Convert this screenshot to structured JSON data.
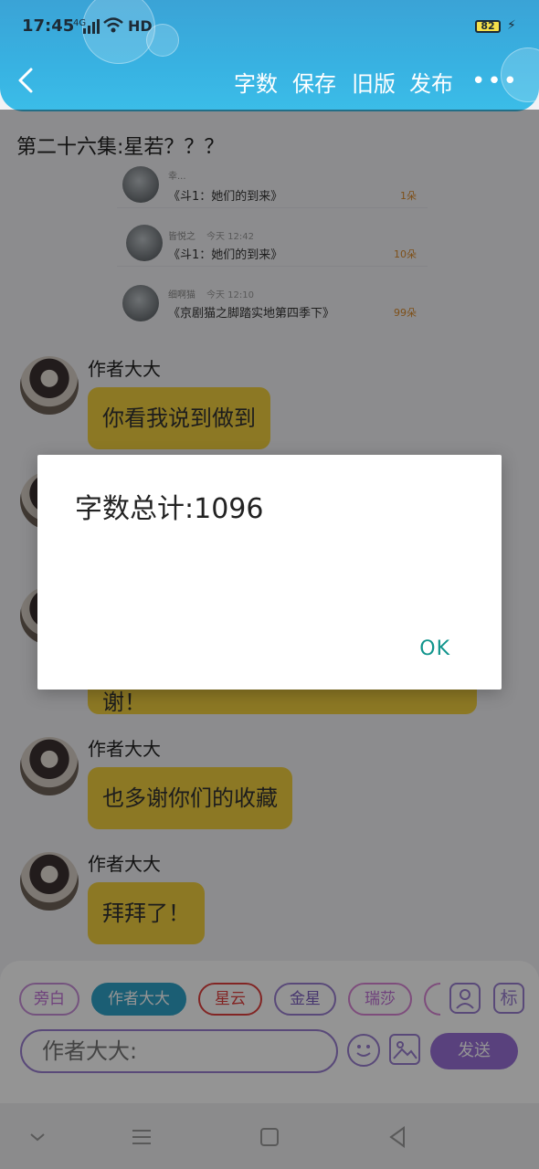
{
  "status_bar": {
    "time": "17:45",
    "network": "4G",
    "hd": "HD",
    "battery": "82"
  },
  "header": {
    "nav": [
      "字数",
      "保存",
      "旧版",
      "发布"
    ],
    "more": "•••"
  },
  "chapter_title": "第二十六集:星若？？？",
  "gift_list": [
    {
      "name": "幸...",
      "time": "",
      "book": "《斗1：她们的到来》",
      "amount": "1朵"
    },
    {
      "name": "皆悦之",
      "time": "今天 12:42",
      "book": "《斗1：她们的到来》",
      "amount": "10朵"
    },
    {
      "name": "细啊猫",
      "time": "今天 12:10",
      "book": "《京剧猫之脚踏实地第四季下》",
      "amount": "99朵"
    }
  ],
  "messages": [
    {
      "sender": "作者大大",
      "text": "你看我说到做到"
    },
    {
      "sender": "",
      "text": ""
    },
    {
      "sender": "",
      "text": "谢！"
    },
    {
      "sender": "作者大大",
      "text": "也多谢你们的收藏"
    },
    {
      "sender": "作者大大",
      "text": "拜拜了！"
    }
  ],
  "dialog": {
    "message": "字数总计:1096",
    "ok_label": "OK"
  },
  "roles": [
    "旁白",
    "作者大大",
    "星云",
    "金星",
    "瑞莎"
  ],
  "role_tools": {
    "person_icon_label": "",
    "mark_label": "标"
  },
  "input": {
    "placeholder": "作者大大:",
    "send_label": "发送"
  },
  "colors": {
    "header": "#38b2e2",
    "bubble": "#f1cf3f",
    "accent": "#9a71d8",
    "ok": "#12958d"
  }
}
